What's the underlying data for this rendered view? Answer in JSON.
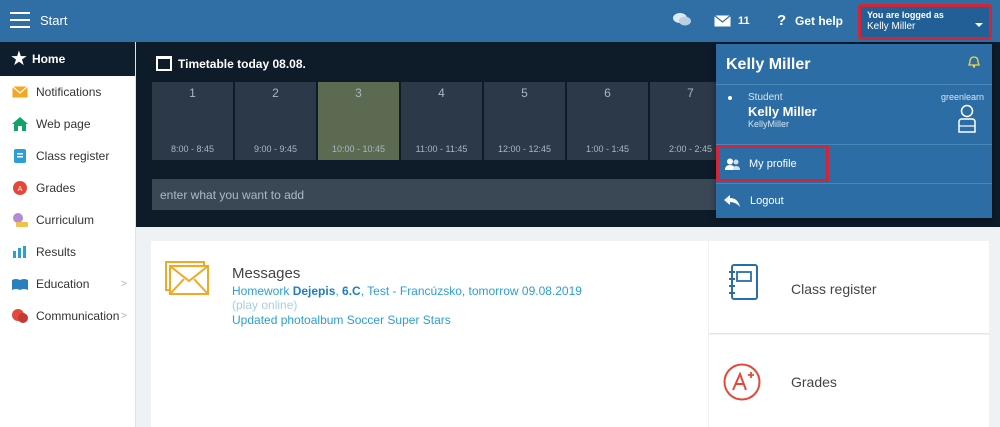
{
  "topbar": {
    "start_label": "Start",
    "mail_count": "11",
    "help_label": "Get help",
    "login_label": "You are logged as",
    "login_user": "Kelly Miller"
  },
  "sidebar": {
    "items": [
      {
        "label": "Home",
        "icon": "star-icon"
      },
      {
        "label": "Notifications",
        "icon": "envelope-icon"
      },
      {
        "label": "Web page",
        "icon": "home-icon"
      },
      {
        "label": "Class register",
        "icon": "register-icon"
      },
      {
        "label": "Grades",
        "icon": "grades-icon"
      },
      {
        "label": "Curriculum",
        "icon": "curriculum-icon"
      },
      {
        "label": "Results",
        "icon": "results-icon"
      },
      {
        "label": "Education",
        "icon": "education-icon"
      },
      {
        "label": "Communication",
        "icon": "communication-icon"
      }
    ]
  },
  "timetable": {
    "title": "Timetable today 08.08.",
    "periods": [
      {
        "num": "1",
        "time": "8:00 - 8:45"
      },
      {
        "num": "2",
        "time": "9:00 - 9:45"
      },
      {
        "num": "3",
        "time": "10:00 - 10:45"
      },
      {
        "num": "4",
        "time": "11:00 - 11:45"
      },
      {
        "num": "5",
        "time": "12:00 - 12:45"
      },
      {
        "num": "6",
        "time": "1:00 - 1:45"
      },
      {
        "num": "7",
        "time": "2:00 - 2:45"
      }
    ],
    "active_period": "3",
    "add_placeholder": "enter what you want to add"
  },
  "messages": {
    "title": "Messages",
    "line1_prefix": "Homework ",
    "line1_subject": "Dejepis",
    "line1_sep": ", ",
    "line1_class": "6.C",
    "line1_rest": ", Test - Francúzsko, tomorrow 09.08.2019",
    "line2": "(play online)",
    "line3": "Updated photoalbum Soccer Super Stars"
  },
  "cards": {
    "class_register": "Class register",
    "grades": "Grades"
  },
  "dropdown": {
    "name": "Kelly Miller",
    "role": "Student",
    "full_name": "Kelly Miller",
    "username": "KellyMiller",
    "brand": "greenlearn",
    "my_profile": "My profile",
    "logout": "Logout"
  },
  "colors": {
    "topbar": "#2f6fa5",
    "highlight": "#d0263a",
    "active_period": "#5d6a52"
  }
}
